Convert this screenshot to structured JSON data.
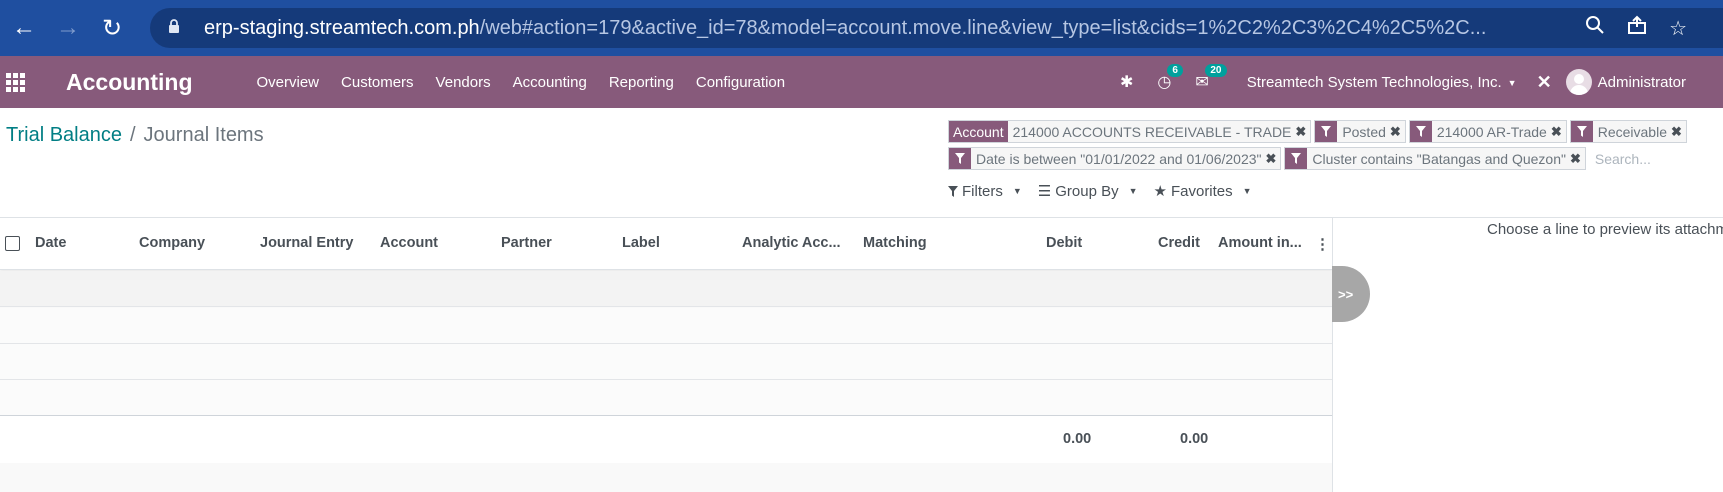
{
  "browser": {
    "url_host": "erp-staging.streamtech.com.ph",
    "url_path": "/web#action=179&active_id=78&model=account.move.line&view_type=list&cids=1%2C2%2C3%2C4%2C5%2C..."
  },
  "navbar": {
    "app_name": "Accounting",
    "menu": [
      "Overview",
      "Customers",
      "Vendors",
      "Accounting",
      "Reporting",
      "Configuration"
    ],
    "activity_count": "6",
    "messages_count": "20",
    "company": "Streamtech System Technologies, Inc.",
    "user": "Administrator"
  },
  "breadcrumb": {
    "parent": "Trial Balance",
    "separator": "/",
    "current": "Journal Items"
  },
  "search": {
    "facets": [
      {
        "type": "field",
        "label": "Account",
        "value": "214000 ACCOUNTS RECEIVABLE - TRADE"
      },
      {
        "type": "filter",
        "value": "Posted"
      },
      {
        "type": "filter",
        "value": "214000 AR-Trade"
      },
      {
        "type": "filter",
        "value": "Receivable"
      },
      {
        "type": "filter",
        "value": "Date is between \"01/01/2022 and 01/06/2023\""
      },
      {
        "type": "filter",
        "value": "Cluster contains \"Batangas and Quezon\""
      }
    ],
    "placeholder": "Search...",
    "filters_label": "Filters",
    "groupby_label": "Group By",
    "favorites_label": "Favorites"
  },
  "list": {
    "columns": [
      "Date",
      "Company",
      "Journal Entry",
      "Account",
      "Partner",
      "Label",
      "Analytic Acc...",
      "Matching",
      "Debit",
      "Credit",
      "Amount in..."
    ],
    "totals": {
      "debit": "0.00",
      "credit": "0.00"
    }
  },
  "preview": {
    "text": "Choose a line to preview its attachments.",
    "toggle_label": ">>"
  },
  "colors": {
    "brand": "#875a7b",
    "browser": "#1f4fa0",
    "link": "#017e84",
    "badge": "#00a09d"
  }
}
